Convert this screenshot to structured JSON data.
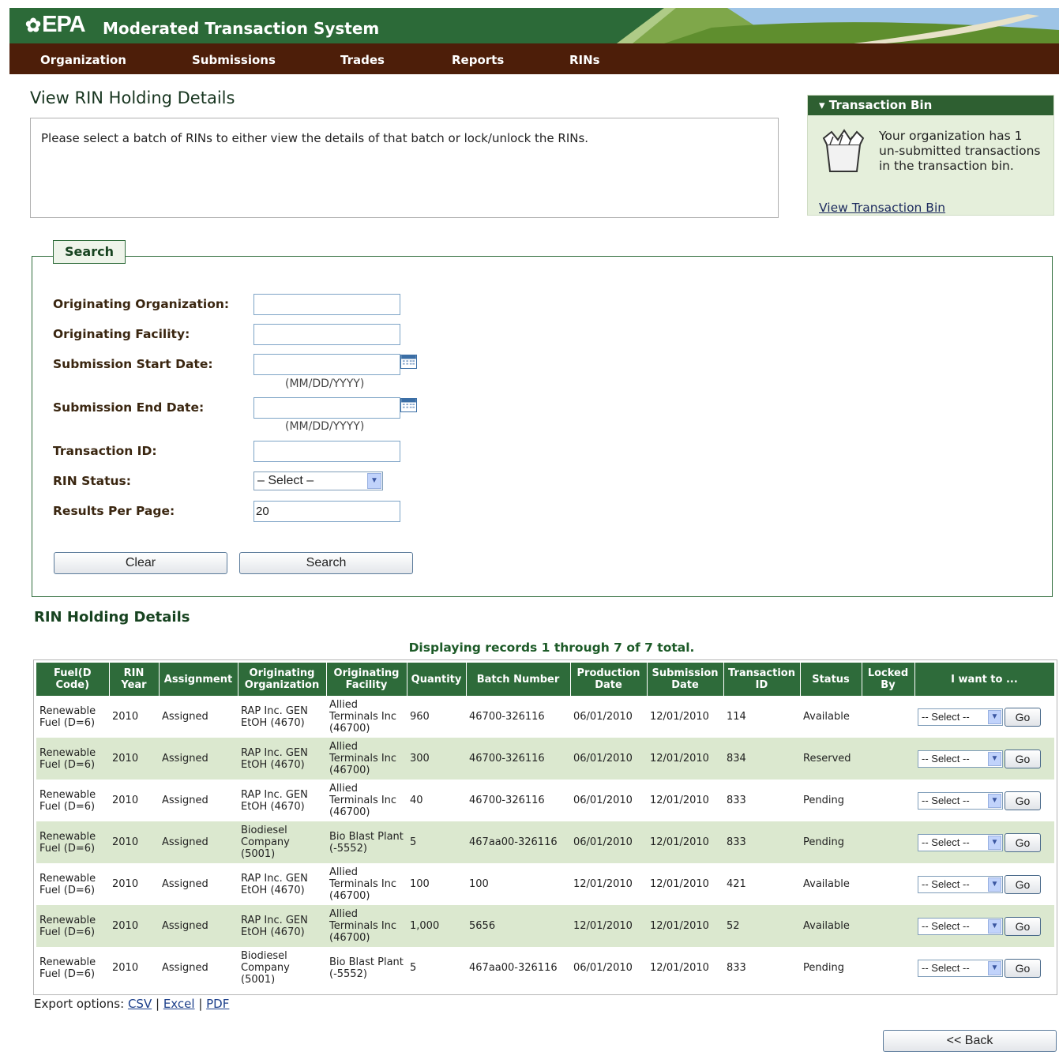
{
  "header": {
    "logo": "EPA",
    "app_title": "Moderated Transaction System"
  },
  "nav": [
    "Organization",
    "Submissions",
    "Trades",
    "Reports",
    "RINs"
  ],
  "page": {
    "title": "View RIN Holding Details",
    "instructions": "Please select a batch of RINs to either view the details of that batch or lock/unlock the RINs."
  },
  "transaction_bin": {
    "title": "Transaction Bin",
    "message": "Your organization has 1 un-submitted transactions in the transaction bin.",
    "link": "View Transaction Bin"
  },
  "search": {
    "legend": "Search",
    "fields": {
      "originating_org": {
        "label": "Originating Organization:",
        "value": ""
      },
      "originating_facility": {
        "label": "Originating Facility:",
        "value": ""
      },
      "start_date": {
        "label": "Submission Start Date:",
        "value": "",
        "hint": "(MM/DD/YYYY)"
      },
      "end_date": {
        "label": "Submission End Date:",
        "value": "",
        "hint": "(MM/DD/YYYY)"
      },
      "transaction_id": {
        "label": "Transaction ID:",
        "value": ""
      },
      "rin_status": {
        "label": "RIN Status:",
        "selected": "– Select –"
      },
      "results_per_page": {
        "label": "Results Per Page:",
        "value": "20"
      }
    },
    "clear_button": "Clear",
    "search_button": "Search"
  },
  "results": {
    "section_title": "RIN Holding Details",
    "records_text": "Displaying records 1 through 7 of 7 total.",
    "columns": [
      "Fuel(D Code)",
      "RIN Year",
      "Assignment",
      "Originating Organization",
      "Originating Facility",
      "Quantity",
      "Batch Number",
      "Production Date",
      "Submission Date",
      "Transaction ID",
      "Status",
      "Locked By",
      "I want to ..."
    ],
    "rows": [
      {
        "fuel": "Renewable Fuel (D=6)",
        "year": "2010",
        "assignment": "Assigned",
        "org": "RAP Inc. GEN EtOH (4670)",
        "facility": "Allied Terminals Inc (46700)",
        "quantity": "960",
        "batch": "46700-326116",
        "production": "06/01/2010",
        "submission": "12/01/2010",
        "transaction": "114",
        "status": "Available",
        "locked_by": "",
        "action": "-- Select --",
        "go": "Go"
      },
      {
        "fuel": "Renewable Fuel (D=6)",
        "year": "2010",
        "assignment": "Assigned",
        "org": "RAP Inc. GEN EtOH (4670)",
        "facility": "Allied Terminals Inc (46700)",
        "quantity": "300",
        "batch": "46700-326116",
        "production": "06/01/2010",
        "submission": "12/01/2010",
        "transaction": "834",
        "status": "Reserved",
        "locked_by": "",
        "action": "-- Select --",
        "go": "Go"
      },
      {
        "fuel": "Renewable Fuel (D=6)",
        "year": "2010",
        "assignment": "Assigned",
        "org": "RAP Inc. GEN EtOH (4670)",
        "facility": "Allied Terminals Inc (46700)",
        "quantity": "40",
        "batch": "46700-326116",
        "production": "06/01/2010",
        "submission": "12/01/2010",
        "transaction": "833",
        "status": "Pending",
        "locked_by": "",
        "action": "-- Select --",
        "go": "Go"
      },
      {
        "fuel": "Renewable Fuel (D=6)",
        "year": "2010",
        "assignment": "Assigned",
        "org": "Biodiesel Company (5001)",
        "facility": "Bio Blast Plant (-5552)",
        "quantity": "5",
        "batch": "467aa00-326116",
        "production": "06/01/2010",
        "submission": "12/01/2010",
        "transaction": "833",
        "status": "Pending",
        "locked_by": "",
        "action": "-- Select --",
        "go": "Go"
      },
      {
        "fuel": "Renewable Fuel (D=6)",
        "year": "2010",
        "assignment": "Assigned",
        "org": "RAP Inc. GEN EtOH (4670)",
        "facility": "Allied Terminals Inc (46700)",
        "quantity": "100",
        "batch": "100",
        "production": "12/01/2010",
        "submission": "12/01/2010",
        "transaction": "421",
        "status": "Available",
        "locked_by": "",
        "action": "-- Select --",
        "go": "Go"
      },
      {
        "fuel": "Renewable Fuel (D=6)",
        "year": "2010",
        "assignment": "Assigned",
        "org": "RAP Inc. GEN EtOH (4670)",
        "facility": "Allied Terminals Inc (46700)",
        "quantity": "1,000",
        "batch": "5656",
        "production": "12/01/2010",
        "submission": "12/01/2010",
        "transaction": "52",
        "status": "Available",
        "locked_by": "",
        "action": "-- Select --",
        "go": "Go"
      },
      {
        "fuel": "Renewable Fuel (D=6)",
        "year": "2010",
        "assignment": "Assigned",
        "org": "Biodiesel Company (5001)",
        "facility": "Bio Blast Plant (-5552)",
        "quantity": "5",
        "batch": "467aa00-326116",
        "production": "06/01/2010",
        "submission": "12/01/2010",
        "transaction": "833",
        "status": "Pending",
        "locked_by": "",
        "action": "-- Select --",
        "go": "Go"
      }
    ]
  },
  "export": {
    "label": "Export options:",
    "csv": "CSV",
    "excel": "Excel",
    "pdf": "PDF"
  },
  "back_button": "<< Back",
  "colors": {
    "header_green": "#2c6a38",
    "nav_brown": "#4d1e09",
    "table_header": "#2e6b3a",
    "row_alt": "#dbe8cf"
  }
}
